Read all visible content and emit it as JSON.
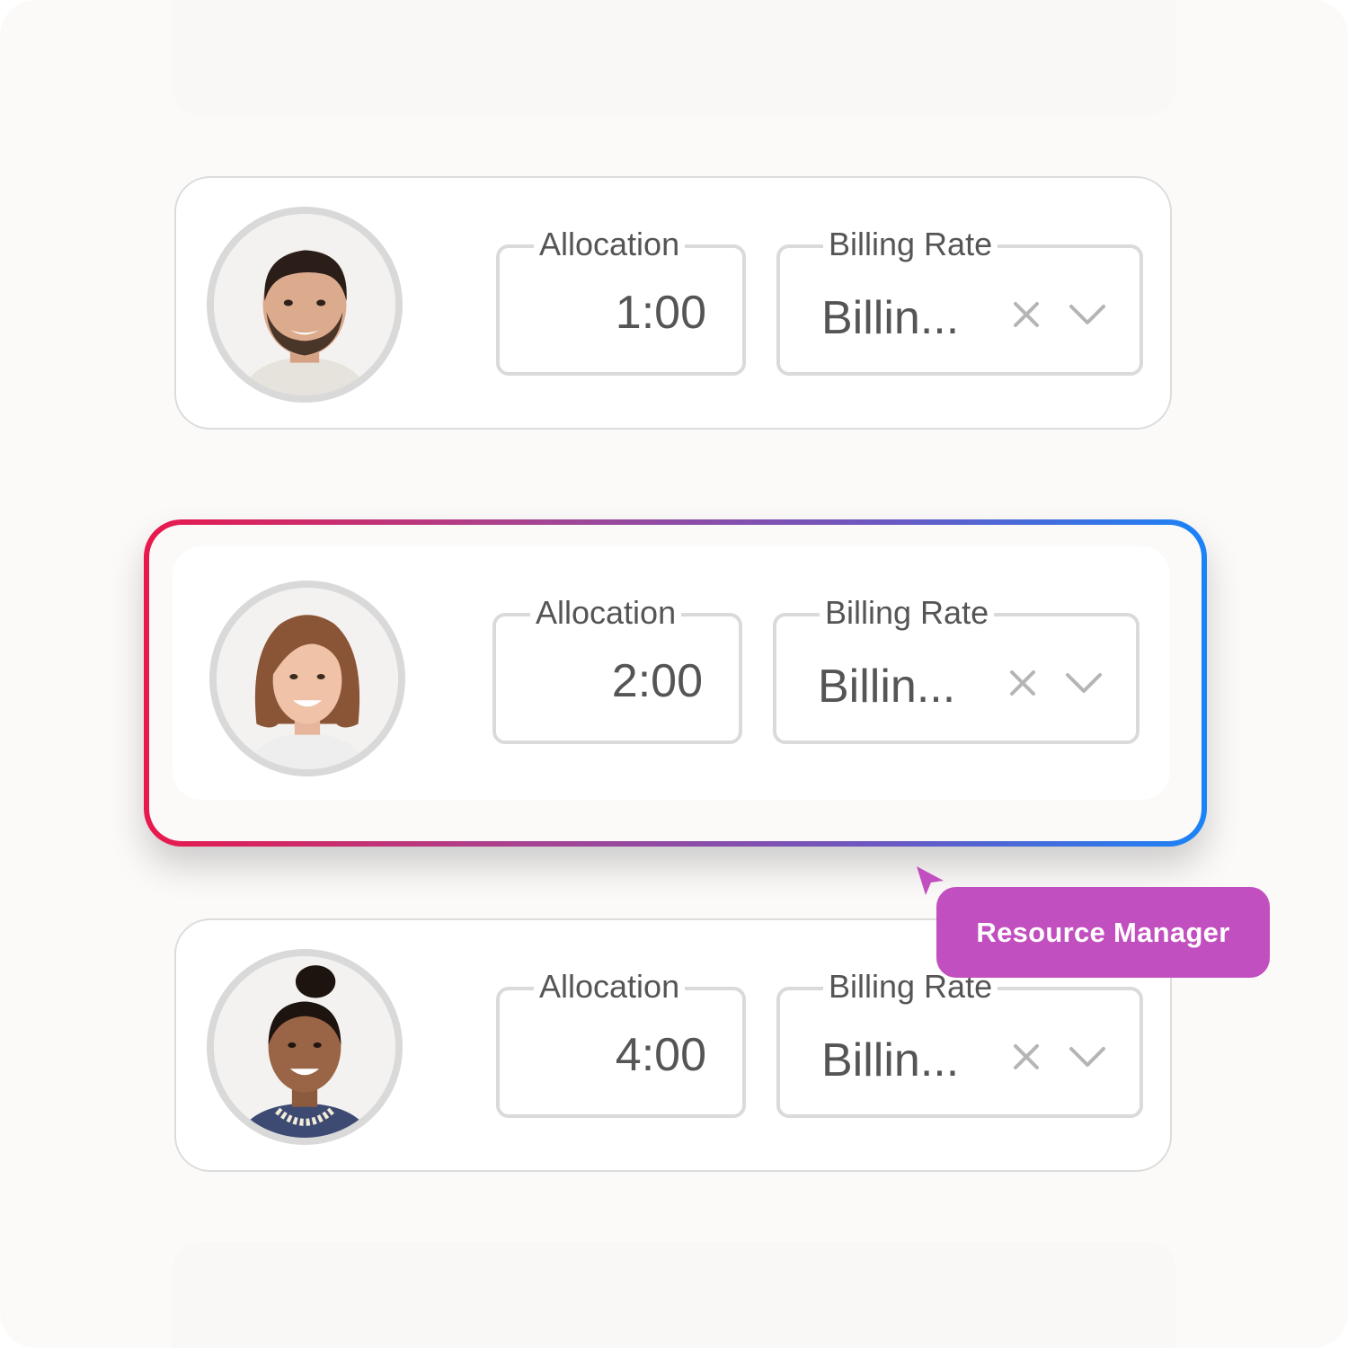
{
  "rows": [
    {
      "allocation_label": "Allocation",
      "allocation_value": "1:00",
      "billing_label": "Billing Rate",
      "billing_value": "Billin...",
      "person": "man-short-dark-hair-beard"
    },
    {
      "allocation_label": "Allocation",
      "allocation_value": "2:00",
      "billing_label": "Billing Rate",
      "billing_value": "Billin...",
      "person": "woman-bob-brown-hair",
      "selected": true
    },
    {
      "allocation_label": "Allocation",
      "allocation_value": "4:00",
      "billing_label": "Billing Rate",
      "billing_value": "Billin...",
      "person": "woman-hair-bun-pearl-necklace"
    }
  ],
  "cursor_label": "Resource Manager",
  "colors": {
    "selection_gradient": [
      "#e8194d",
      "#a9428f",
      "#1a83f7"
    ],
    "tooltip": "#c24fbf",
    "field_border": "#dadada",
    "text": "#555555"
  },
  "icons": {
    "clear": "close-x-icon",
    "dropdown": "chevron-down-icon",
    "pointer": "cursor-arrow-icon"
  }
}
